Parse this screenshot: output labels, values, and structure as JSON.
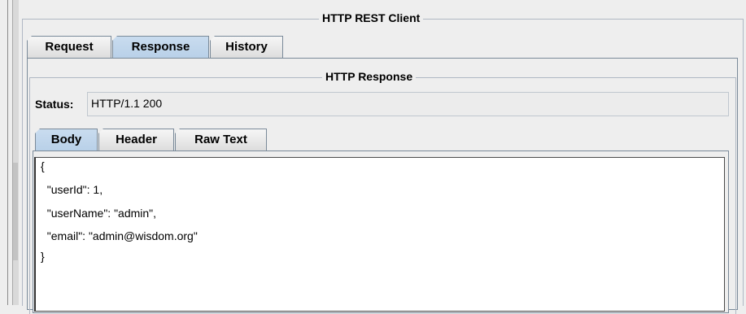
{
  "window": {
    "title": "HTTP REST Client"
  },
  "tabs": [
    {
      "label": "Request"
    },
    {
      "label": "Response"
    },
    {
      "label": "History"
    }
  ],
  "response": {
    "title": "HTTP Response",
    "status_label": "Status:",
    "status_value": "HTTP/1.1 200",
    "tabs": [
      {
        "label": "Body"
      },
      {
        "label": "Header"
      },
      {
        "label": "Raw Text"
      }
    ],
    "body_lines": [
      "{",
      "  \"userId\": 1,",
      "  \"userName\": \"admin\",",
      "  \"email\": \"admin@wisdom.org\"",
      "}"
    ]
  }
}
